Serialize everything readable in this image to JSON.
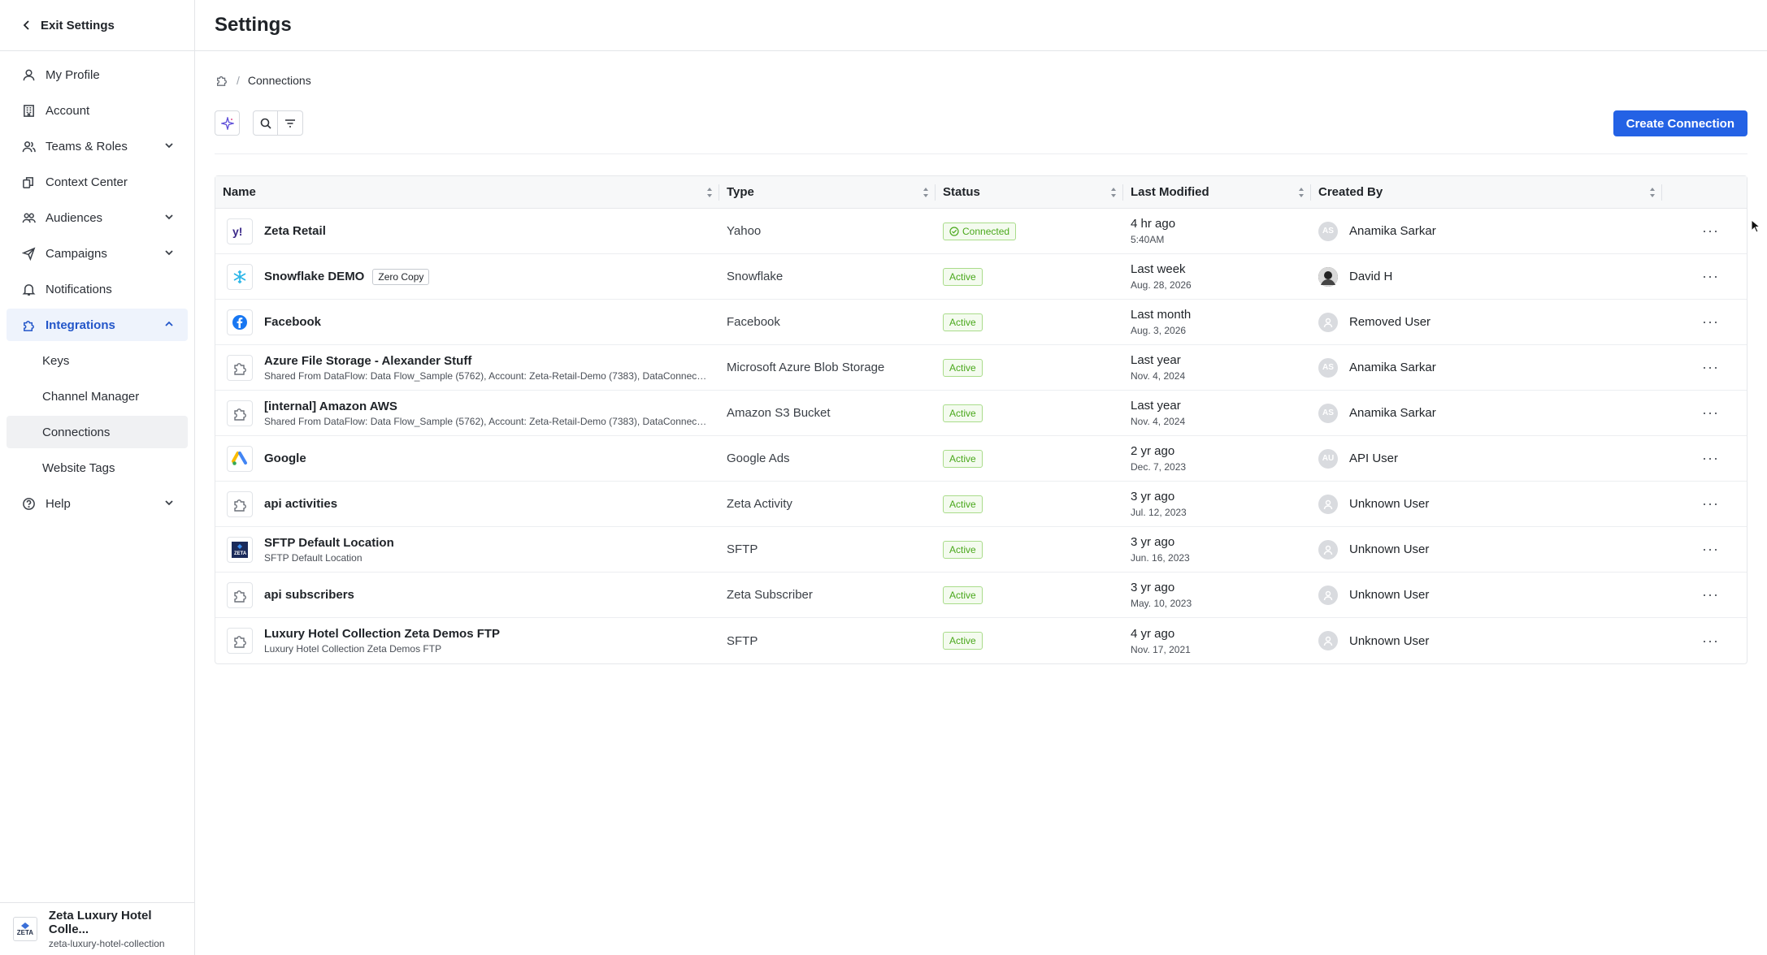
{
  "sidebar": {
    "exit_label": "Exit Settings",
    "items": [
      {
        "label": "My Profile",
        "icon": "user-icon"
      },
      {
        "label": "Account",
        "icon": "building-icon"
      },
      {
        "label": "Teams & Roles",
        "icon": "team-icon"
      },
      {
        "label": "Context Center",
        "icon": "context-icon"
      },
      {
        "label": "Audiences",
        "icon": "audiences-icon"
      },
      {
        "label": "Campaigns",
        "icon": "send-icon"
      },
      {
        "label": "Notifications",
        "icon": "bell-icon"
      },
      {
        "label": "Integrations",
        "icon": "puzzle-icon"
      }
    ],
    "integrations_sub": [
      "Keys",
      "Channel Manager",
      "Connections",
      "Website Tags"
    ],
    "help_label": "Help",
    "org": {
      "name": "Zeta Luxury Hotel Colle...",
      "slug": "zeta-luxury-hotel-collection",
      "logo_text": "ZETA"
    }
  },
  "header": {
    "title": "Settings"
  },
  "breadcrumb": {
    "current": "Connections"
  },
  "toolbar": {
    "create_label": "Create Connection"
  },
  "colors": {
    "accent": "#2462e5",
    "active_bg": "#eef3fc",
    "status_green": "#4aa81c"
  },
  "table": {
    "columns": [
      "Name",
      "Type",
      "Status",
      "Last Modified",
      "Created By"
    ],
    "rows": [
      {
        "name": "Zeta Retail",
        "sub": "",
        "tag": "",
        "icon": "yahoo-icon",
        "type": "Yahoo",
        "status": "Connected",
        "mod": "4 hr ago",
        "mod_sub": "5:40AM",
        "by": "Anamika Sarkar",
        "avatar": "AS"
      },
      {
        "name": "Snowflake DEMO",
        "sub": "",
        "tag": "Zero Copy",
        "icon": "snowflake-icon",
        "type": "Snowflake",
        "status": "Active",
        "mod": "Last week",
        "mod_sub": "Aug. 28, 2026",
        "by": "David H",
        "avatar": ""
      },
      {
        "name": "Facebook",
        "sub": "",
        "tag": "",
        "icon": "facebook-icon",
        "type": "Facebook",
        "status": "Active",
        "mod": "Last month",
        "mod_sub": "Aug. 3, 2026",
        "by": "Removed User",
        "avatar": ""
      },
      {
        "name": "Azure File Storage - Alexander Stuff",
        "sub": "Shared From DataFlow: Data Flow_Sample (5762), Account: Zeta-Retail-Demo (7383), DataConnectio...",
        "tag": "",
        "icon": "puzzle-icon",
        "type": "Microsoft Azure Blob Storage",
        "status": "Active",
        "mod": "Last year",
        "mod_sub": "Nov. 4, 2024",
        "by": "Anamika Sarkar",
        "avatar": "AS"
      },
      {
        "name": "[internal] Amazon AWS",
        "sub": "Shared From DataFlow: Data Flow_Sample (5762), Account: Zeta-Retail-Demo (7383), DataConnectio...",
        "tag": "",
        "icon": "puzzle-icon",
        "type": "Amazon S3 Bucket",
        "status": "Active",
        "mod": "Last year",
        "mod_sub": "Nov. 4, 2024",
        "by": "Anamika Sarkar",
        "avatar": "AS"
      },
      {
        "name": "Google",
        "sub": "",
        "tag": "",
        "icon": "google-ads-icon",
        "type": "Google Ads",
        "status": "Active",
        "mod": "2 yr ago",
        "mod_sub": "Dec. 7, 2023",
        "by": "API User",
        "avatar": "AU"
      },
      {
        "name": "api activities",
        "sub": "",
        "tag": "",
        "icon": "puzzle-icon",
        "type": "Zeta Activity",
        "status": "Active",
        "mod": "3 yr ago",
        "mod_sub": "Jul. 12, 2023",
        "by": "Unknown User",
        "avatar": ""
      },
      {
        "name": "SFTP Default Location",
        "sub": "SFTP Default Location",
        "tag": "",
        "icon": "zeta-icon",
        "type": "SFTP",
        "status": "Active",
        "mod": "3 yr ago",
        "mod_sub": "Jun. 16, 2023",
        "by": "Unknown User",
        "avatar": ""
      },
      {
        "name": "api subscribers",
        "sub": "",
        "tag": "",
        "icon": "puzzle-icon",
        "type": "Zeta Subscriber",
        "status": "Active",
        "mod": "3 yr ago",
        "mod_sub": "May. 10, 2023",
        "by": "Unknown User",
        "avatar": ""
      },
      {
        "name": "Luxury Hotel Collection Zeta Demos FTP",
        "sub": "Luxury Hotel Collection Zeta Demos FTP",
        "tag": "",
        "icon": "puzzle-icon",
        "type": "SFTP",
        "status": "Active",
        "mod": "4 yr ago",
        "mod_sub": "Nov. 17, 2021",
        "by": "Unknown User",
        "avatar": ""
      }
    ]
  }
}
